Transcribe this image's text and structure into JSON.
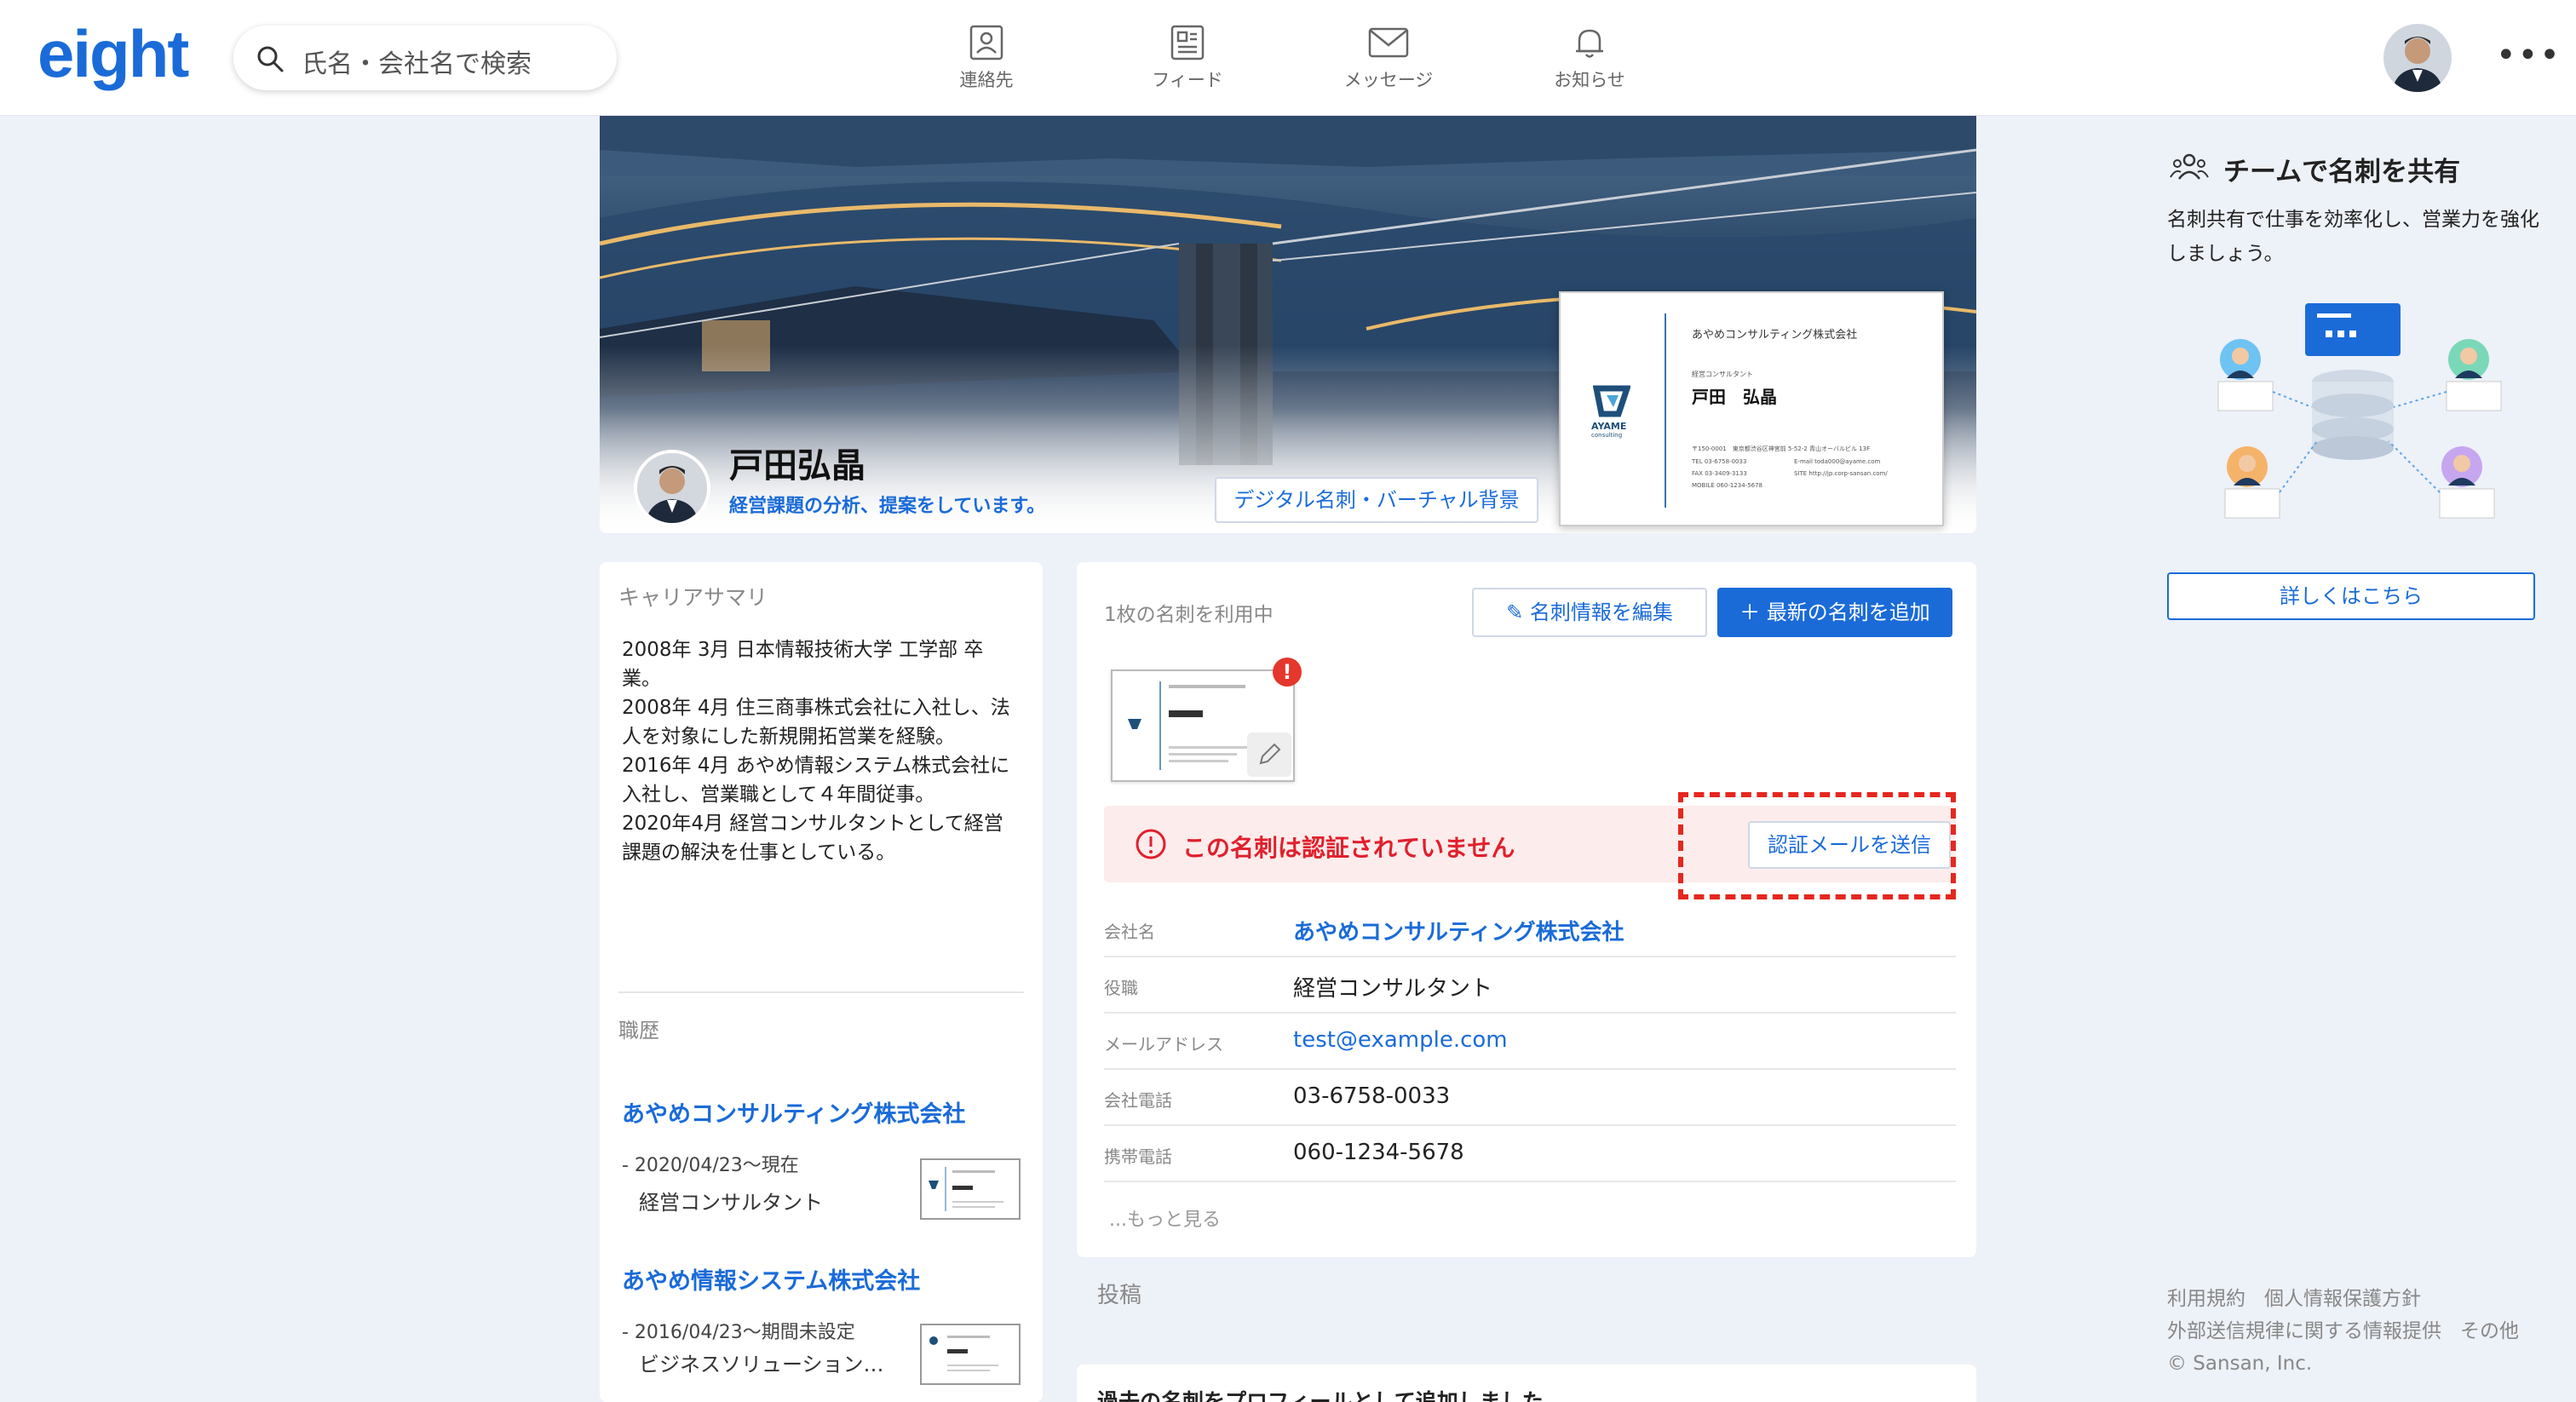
{
  "header": {
    "logo": "eight",
    "search_placeholder": "氏名・会社名で検索",
    "nav": [
      {
        "label": "連絡先",
        "icon": "contacts-icon"
      },
      {
        "label": "フィード",
        "icon": "feed-icon"
      },
      {
        "label": "メッセージ",
        "icon": "message-icon"
      },
      {
        "label": "お知らせ",
        "icon": "bell-icon"
      }
    ],
    "more": "•••"
  },
  "profile": {
    "name": "戸田弘晶",
    "tagline": "経営課題の分析、提案をしています。",
    "digital_button": "デジタル名刺・バーチャル背景",
    "card": {
      "company": "あやめコンサルティング株式会社",
      "title": "経営コンサルタント",
      "name": "戸田　弘晶",
      "brand": "AYAME",
      "brand_sub": "consulting",
      "address": "〒150-0001　東京都渋谷区神宮前 5-52-2 青山オーバルビル 13F",
      "tel": "TEL 03-6758-0033",
      "fax": "FAX 03-3409-3133",
      "mobile": "MOBILE 060-1234-5678",
      "email": "E-mail toda000@ayame.com",
      "site": "SITE http://jp.corp-sansan.com/"
    }
  },
  "career": {
    "heading": "キャリアサマリ",
    "summary": "2008年 3月 日本情報技術大学 工学部 卒業。\n2008年 4月 住三商事株式会社に入社し、法人を対象にした新規開拓営業を経験。\n2016年 4月 あやめ情報システム株式会社に入社し、営業職として４年間従事。\n2020年4月 経営コンサルタントとして経営課題の解決を仕事としている。",
    "history_label": "職歴",
    "history": [
      {
        "company": "あやめコンサルティング株式会社",
        "period": "- 2020/04/23〜現在",
        "role": "経営コンサルタント"
      },
      {
        "company": "あやめ情報システム株式会社",
        "period": "- 2016/04/23〜期間未設定",
        "role": "ビジネスソリューション…"
      }
    ]
  },
  "cards_panel": {
    "using_label": "1枚の名刺を利用中",
    "edit_button": "名刺情報を編集",
    "add_button": "最新の名刺を追加",
    "alert_badge": "!",
    "warning": "この名刺は認証されていません",
    "send_button": "認証メールを送信",
    "fields": [
      {
        "key": "会社名",
        "value": "あやめコンサルティング株式会社",
        "style": "link bold"
      },
      {
        "key": "役職",
        "value": "経営コンサルタント",
        "style": ""
      },
      {
        "key": "メールアドレス",
        "value": "test@example.com",
        "style": "link"
      },
      {
        "key": "会社電話",
        "value": "03-6758-0033",
        "style": ""
      },
      {
        "key": "携帯電話",
        "value": "060-1234-5678",
        "style": ""
      }
    ],
    "more_link": "...もっと見る"
  },
  "posts": {
    "label": "投稿",
    "first_post": "過去の名刺をプロフィールとして追加しました"
  },
  "sidebar": {
    "title": "チームで名刺を共有",
    "description": "名刺共有で仕事を効率化し、営業力を強化しましょう。",
    "detail_button": "詳しくはこちら",
    "footer": {
      "links": [
        "利用規約",
        "個人情報保護方針",
        "外部送信規律に関する情報提供",
        "その他"
      ],
      "copyright": "© Sansan, Inc."
    }
  },
  "colors": {
    "brand": "#1a6bd8",
    "warning": "#e0202c",
    "background": "#edf1f8"
  }
}
